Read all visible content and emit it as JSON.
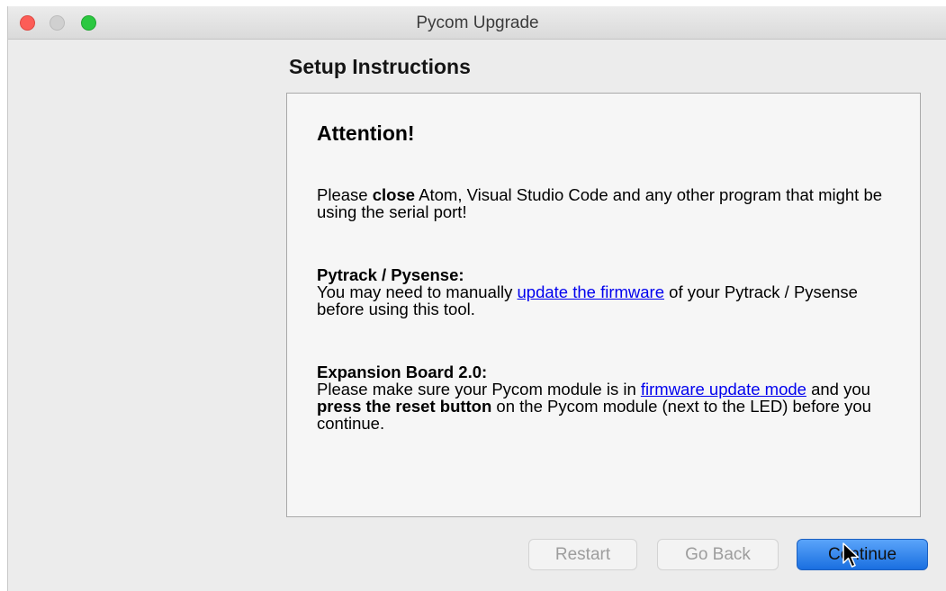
{
  "window": {
    "title": "Pycom Upgrade",
    "controls": [
      "close",
      "minimize",
      "zoom"
    ]
  },
  "section_title": "Setup Instructions",
  "panel": {
    "heading": "Attention!",
    "close_notice": {
      "prefix": "Please ",
      "bold": "close",
      "suffix": " Atom, Visual Studio Code and any other program that might be using the serial port!"
    },
    "pytrack": {
      "heading": "Pytrack / Pysense:",
      "text_before": "You may need to manually ",
      "link": "update the firmware",
      "text_after": " of your Pytrack / Pysense before using this tool."
    },
    "expansion": {
      "heading": "Expansion Board 2.0:",
      "text_before": "Please make sure your Pycom module is in ",
      "link": "firmware update mode",
      "text_middle": " and you ",
      "bold": "press the reset button",
      "text_after": " on the Pycom module (next to the LED) before you continue."
    }
  },
  "buttons": {
    "restart": "Restart",
    "go_back": "Go Back",
    "continue": "Continue"
  },
  "colors": {
    "link": "#0000ee",
    "primary_button": "#2a7ff0",
    "close": "#fc5d57",
    "zoom": "#2bc840"
  }
}
